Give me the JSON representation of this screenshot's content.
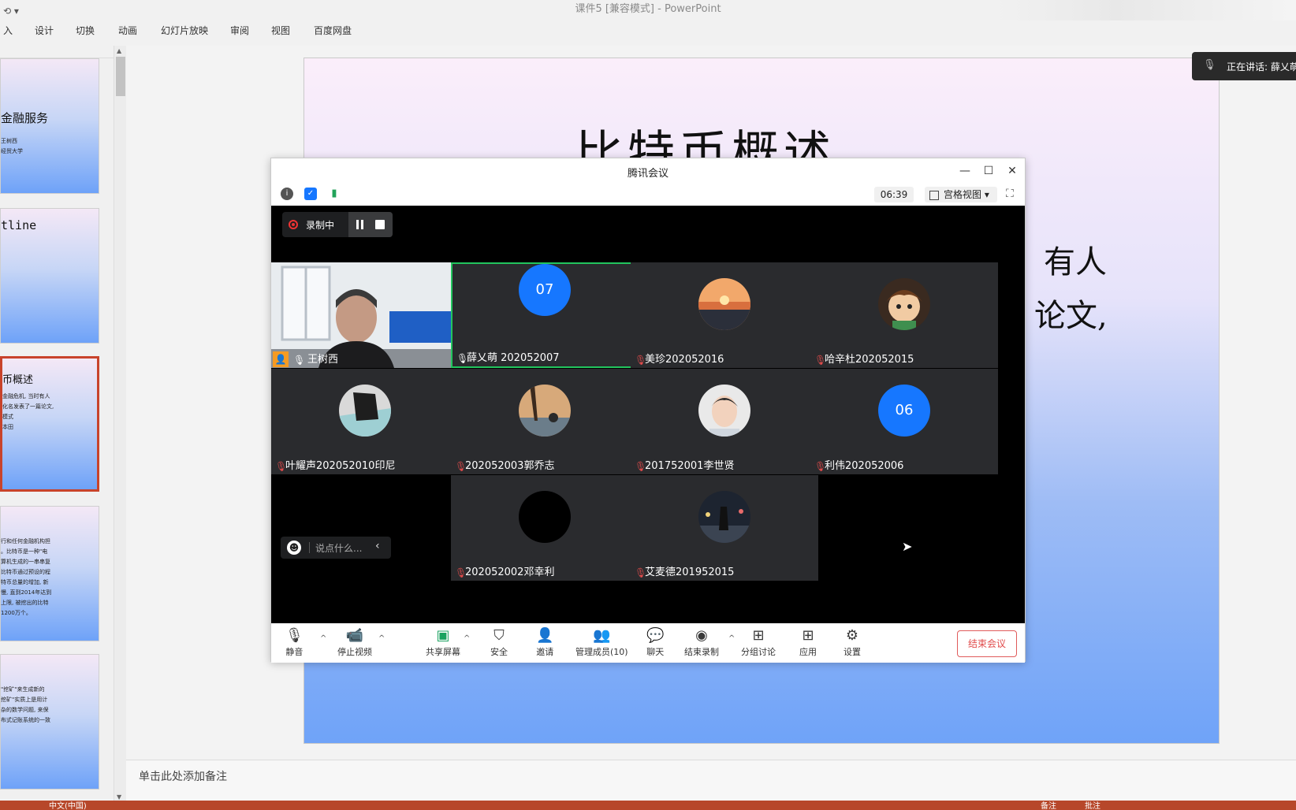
{
  "powerpoint": {
    "title": "课件5 [兼容模式] - PowerPoint",
    "ribbon_tabs": [
      "入",
      "设计",
      "切换",
      "动画",
      "幻灯片放映",
      "审阅",
      "视图",
      "百度网盘"
    ],
    "slide_title": "比特币概述",
    "slide_lines": [
      "有人",
      "论文,"
    ],
    "notes_placeholder": "单击此处添加备注",
    "status_text": "中文(中国)",
    "status_right": [
      "备注",
      "批注"
    ],
    "thumbnails": [
      {
        "title": "金融服务",
        "sub": "王树西\n经贸大学"
      },
      {
        "title": "tline",
        "sub": ""
      },
      {
        "title": "币概述",
        "sub": "金融危机, 当时有人\n化名发表了一篇论文,\n模式\n本田"
      },
      {
        "title": "",
        "sub": "行和任何金融机构担\n。比特币是一种\"电\n算机生成的一串串复\n比特币通过预设的程\n特币总量的增加, 新\n慢, 直到2014年达到\n上限, 被挖出的比特\n1200万个。"
      },
      {
        "title": "",
        "sub": "\"挖矿\"来生成新的\n挖矿\"实质上是用计\n杂的数学问题, 来保\n布式记账系统的一致"
      }
    ]
  },
  "speaking": {
    "label": "正在讲话: 薛乂萌"
  },
  "meeting": {
    "window_title": "腾讯会议",
    "timer": "06:39",
    "view_mode": "宫格视图",
    "recording_label": "录制中",
    "chat_placeholder": "说点什么...",
    "participants": [
      {
        "name": "王树西",
        "muted": false,
        "avatar": "video",
        "active": false
      },
      {
        "name": "薛乂萌 202052007",
        "muted": false,
        "avatar": "07",
        "active": true
      },
      {
        "name": "美珍202052016",
        "muted": true,
        "avatar": "sunset",
        "active": false
      },
      {
        "name": "哈辛杜202052015",
        "muted": true,
        "avatar": "cartoon",
        "active": false
      },
      {
        "name": "叶耀声202052010印尼",
        "muted": true,
        "avatar": "photo",
        "active": false
      },
      {
        "name": "202052003郭乔志",
        "muted": true,
        "avatar": "tree",
        "active": false
      },
      {
        "name": "201752001李世贤",
        "muted": true,
        "avatar": "face",
        "active": false
      },
      {
        "name": "利伟202052006",
        "muted": true,
        "avatar": "06",
        "active": false
      },
      {
        "name": "202052002邓幸利",
        "muted": true,
        "avatar": "black",
        "active": false
      },
      {
        "name": "艾麦德201952015",
        "muted": true,
        "avatar": "night",
        "active": false
      }
    ],
    "toolbar": {
      "mute": "静音",
      "stop_video": "停止视频",
      "share": "共享屏幕",
      "security": "安全",
      "invite": "邀请",
      "members": "管理成员(10)",
      "chat": "聊天",
      "end_record": "结束录制",
      "breakout": "分组讨论",
      "apps": "应用",
      "settings": "设置",
      "end_meeting": "结束会议"
    }
  },
  "colors": {
    "accent": "#1677ff",
    "active_border": "#22c55e",
    "danger": "#e14b4b",
    "status_bar": "#b7472a"
  }
}
